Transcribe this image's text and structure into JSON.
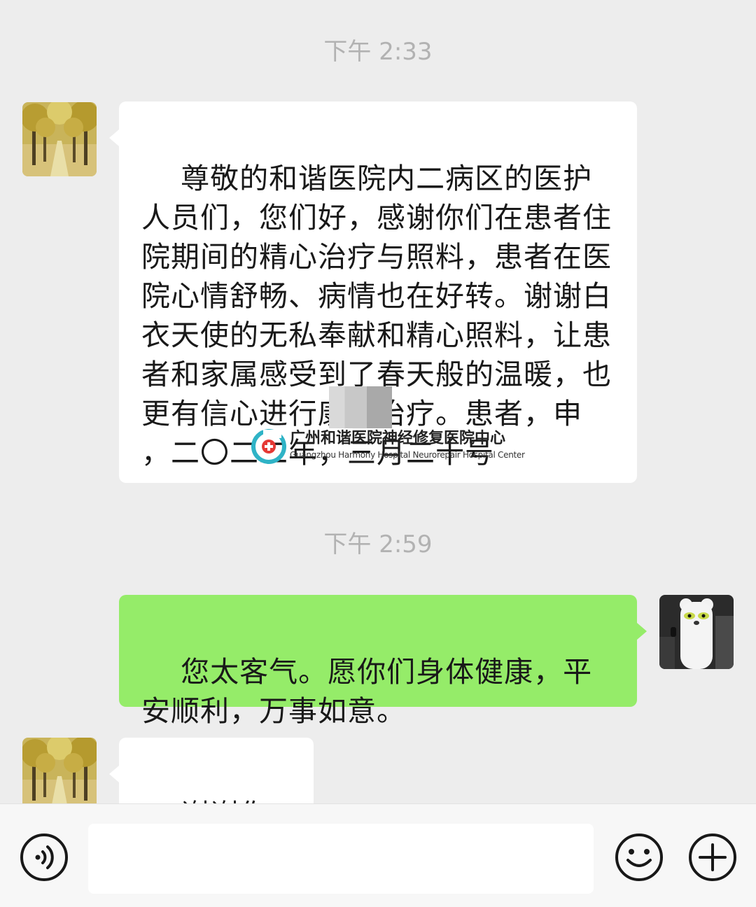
{
  "chat": {
    "messages": [
      {
        "timestamp": "下午 2:33",
        "sender": "other",
        "text": "尊敬的和谐医院内二病区的医护人员们，您们好，感谢你们在患者住院期间的精心治疗与照料，患者在医院心情舒畅、病情也在好转。谢谢白衣天使的无私奉献和精心照料，让患者和家属感受到了春天般的温暖，也更有信心进行康复治疗。患者，申　　，二〇二二年，三月二十号"
      },
      {
        "timestamp": "下午 2:59",
        "sender": "self",
        "text": "您太客气。愿你们身体健康，平安顺利，万事如意。"
      },
      {
        "sender": "other",
        "text": "谢谢你了,"
      }
    ]
  },
  "watermark": {
    "title": "广州和谐医院神经修复医院中心",
    "subtitle": "Guangzhou Harmony Hospital Neurorepair Hospital Center"
  },
  "input_bar": {
    "voice_icon": "voice-icon",
    "emoji_icon": "emoji-icon",
    "add_icon": "plus-icon",
    "input_value": ""
  },
  "colors": {
    "background": "#ededed",
    "incoming_bubble": "#ffffff",
    "outgoing_bubble": "#95ec69",
    "timestamp_text": "#b2b2b2"
  }
}
